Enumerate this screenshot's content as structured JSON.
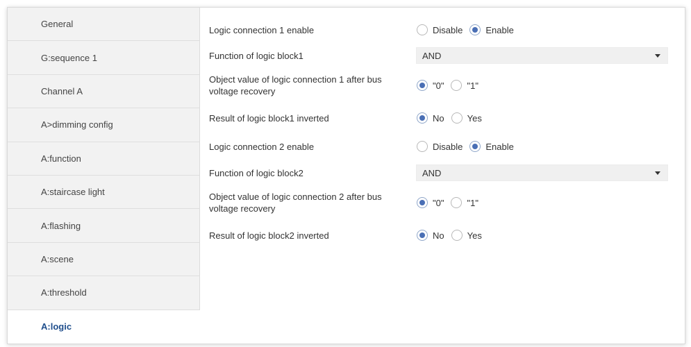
{
  "sidebar": {
    "items": [
      {
        "label": "General"
      },
      {
        "label": "G:sequence 1"
      },
      {
        "label": "Channel A"
      },
      {
        "label": "A>dimming config"
      },
      {
        "label": "A:function"
      },
      {
        "label": "A:staircase light"
      },
      {
        "label": "A:flashing"
      },
      {
        "label": "A:scene"
      },
      {
        "label": "A:threshold"
      },
      {
        "label": "A:logic"
      }
    ],
    "active_index": 9
  },
  "params": {
    "logic1_enable": {
      "label": "Logic connection 1 enable",
      "options": [
        "Disable",
        "Enable"
      ],
      "selected": "Enable"
    },
    "logic1_function": {
      "label": "Function of logic block1",
      "value": "AND"
    },
    "logic1_object_value": {
      "label": "Object value of logic connection 1 after bus voltage recovery",
      "options": [
        "\"0\"",
        "\"1\""
      ],
      "selected": "\"0\""
    },
    "logic1_inverted": {
      "label": "Result of logic block1 inverted",
      "options": [
        "No",
        "Yes"
      ],
      "selected": "No"
    },
    "logic2_enable": {
      "label": "Logic connection 2 enable",
      "options": [
        "Disable",
        "Enable"
      ],
      "selected": "Enable"
    },
    "logic2_function": {
      "label": "Function of logic block2",
      "value": "AND"
    },
    "logic2_object_value": {
      "label": "Object value of logic connection 2 after bus voltage recovery",
      "options": [
        "\"0\"",
        "\"1\""
      ],
      "selected": "\"0\""
    },
    "logic2_inverted": {
      "label": "Result of logic block2 inverted",
      "options": [
        "No",
        "Yes"
      ],
      "selected": "No"
    }
  },
  "colors": {
    "accent": "#4a6fb5",
    "active_text": "#1f4e8c",
    "sidebar_bg": "#f2f2f2"
  },
  "icons": {
    "dropdown": "chevron-down-icon"
  }
}
